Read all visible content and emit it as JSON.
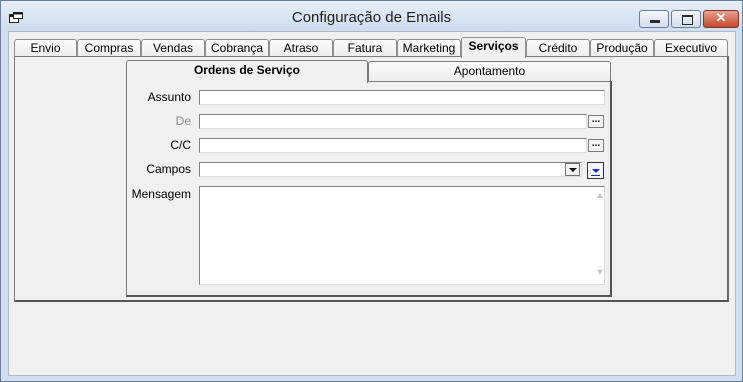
{
  "window": {
    "title": "Configuração de Emails",
    "close_glyph": "✕"
  },
  "tabs": [
    {
      "label": "Envio"
    },
    {
      "label": "Compras"
    },
    {
      "label": "Vendas"
    },
    {
      "label": "Cobrança"
    },
    {
      "label": "Atraso"
    },
    {
      "label": "Fatura"
    },
    {
      "label": "Marketing"
    },
    {
      "label": "Serviços",
      "active": true
    },
    {
      "label": "Crédito"
    },
    {
      "label": "Produção"
    },
    {
      "label": "Executivo"
    }
  ],
  "subtabs": [
    {
      "label": "Ordens de Serviço",
      "active": true
    },
    {
      "label": "Apontamento"
    }
  ],
  "form": {
    "assunto_label": "Assunto",
    "assunto_value": "",
    "de_label": "De",
    "de_value": "",
    "cc_label": "C/C",
    "cc_value": "",
    "campos_label": "Campos",
    "campos_value": "",
    "mensagem_label": "Mensagem",
    "mensagem_value": "",
    "ellipsis": "..."
  },
  "icons": [
    "app-icon",
    "minimize-icon",
    "maximize-icon",
    "close-icon",
    "ellipsis-icon",
    "dropdown-arrow-icon",
    "insert-field-icon",
    "scroll-up-icon",
    "scroll-down-icon"
  ],
  "colors": {
    "title_bg": "#dbe6f4",
    "close_button": "#c6472c",
    "insert_arrow": "#1b2fb5"
  }
}
